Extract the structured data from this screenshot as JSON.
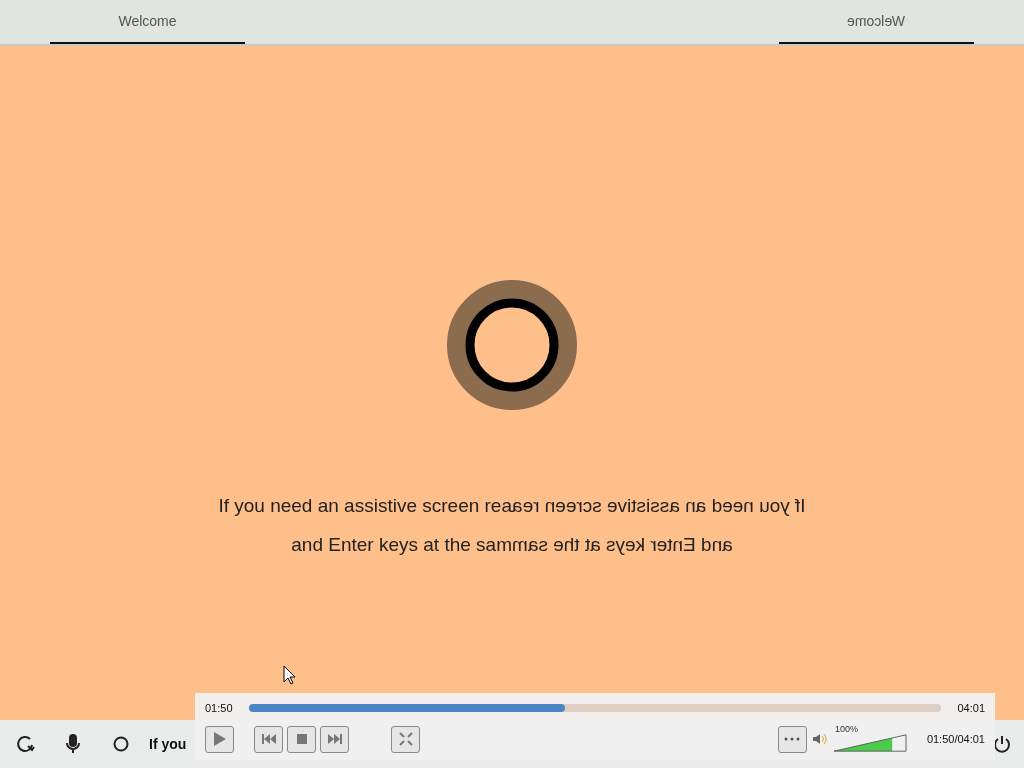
{
  "header": {
    "tabs": [
      {
        "label": "Welcome",
        "mirrored": false
      },
      {
        "label": "Welcome",
        "mirrored": true
      }
    ]
  },
  "caption": {
    "lines": [
      {
        "text": "If you need an assistive screen rea",
        "mirrored_text": "If you need an assistive screen rea"
      },
      {
        "text": "and Enter keys at the sam",
        "mirrored_text": "and Enter keys at the sam"
      }
    ]
  },
  "taskbar": {
    "hint": "If you"
  },
  "player": {
    "current_time": "01:50",
    "progress": {
      "level": 0.456
    },
    "total_time": "04:01",
    "volume": {
      "label": "100%",
      "level": 0.8
    },
    "time_display": "01:50/04:01"
  }
}
